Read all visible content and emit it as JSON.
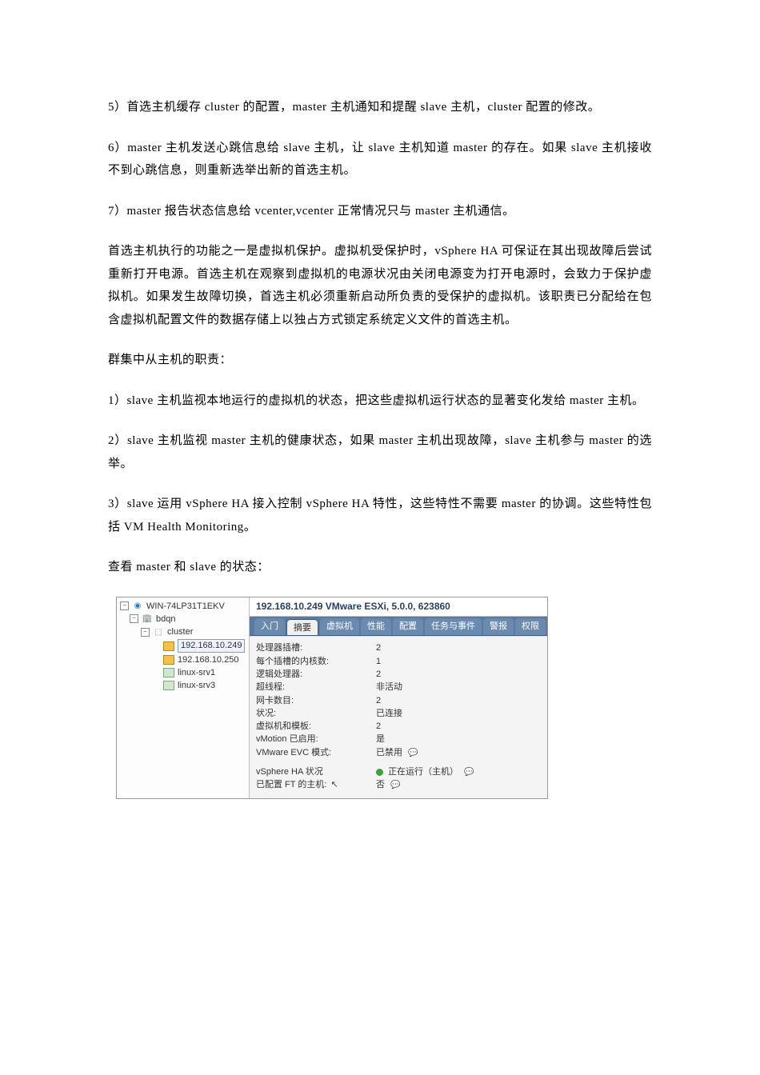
{
  "paragraphs": {
    "p5": "5）首选主机缓存 cluster 的配置，master 主机通知和提醒 slave 主机，cluster 配置的修改。",
    "p6": "6）master 主机发送心跳信息给 slave 主机，让 slave 主机知道 master 的存在。如果 slave 主机接收不到心跳信息，则重新选举出新的首选主机。",
    "p7": "7）master 报告状态信息给 vcenter,vcenter 正常情况只与 master 主机通信。",
    "p8": "首选主机执行的功能之一是虚拟机保护。虚拟机受保护时，vSphere HA 可保证在其出现故障后尝试重新打开电源。首选主机在观察到虚拟机的电源状况由关闭电源变为打开电源时，会致力于保护虚拟机。如果发生故障切换，首选主机必须重新启动所负责的受保护的虚拟机。该职责已分配给在包含虚拟机配置文件的数据存储上以独占方式锁定系统定义文件的首选主机。",
    "p9": "群集中从主机的职责：",
    "p10": "1）slave 主机监视本地运行的虚拟机的状态，把这些虚拟机运行状态的显著变化发给 master 主机。",
    "p11": "2）slave 主机监视 master 主机的健康状态，如果 master 主机出现故障，slave 主机参与 master 的选举。",
    "p12": "3）slave 运用 vSphere HA 接入控制 vSphere HA 特性，这些特性不需要 master 的协调。这些特性包括 VM Health Monitoring。",
    "p13": "查看 master 和 slave 的状态："
  },
  "screenshot": {
    "tree": {
      "root": "WIN-74LP31T1EKV",
      "datacenter": "bdqn",
      "cluster": "cluster",
      "hosts": [
        "192.168.10.249",
        "192.168.10.250"
      ],
      "vms": [
        "linux-srv1",
        "linux-srv3"
      ]
    },
    "title": "192.168.10.249 VMware ESXi, 5.0.0, 623860",
    "tabs": [
      "入门",
      "摘要",
      "虚拟机",
      "性能",
      "配置",
      "任务与事件",
      "警报",
      "权限"
    ],
    "details": [
      {
        "label": "处理器插槽:",
        "value": "2"
      },
      {
        "label": "每个插槽的内核数:",
        "value": "1"
      },
      {
        "label": "逻辑处理器:",
        "value": "2"
      },
      {
        "label": "超线程:",
        "value": "非活动"
      },
      {
        "label": "网卡数目:",
        "value": "2"
      },
      {
        "label": "状况:",
        "value": "已连接"
      },
      {
        "label": "虚拟机和模板:",
        "value": "2"
      },
      {
        "label": "vMotion 已启用:",
        "value": "是"
      },
      {
        "label": "VMware EVC 模式:",
        "value": "已禁用",
        "balloon": true
      }
    ],
    "ha": {
      "label": "vSphere HA 状况",
      "value": "正在运行（主机）",
      "ft_label": "已配置 FT 的主机:",
      "ft_value": "否"
    }
  }
}
